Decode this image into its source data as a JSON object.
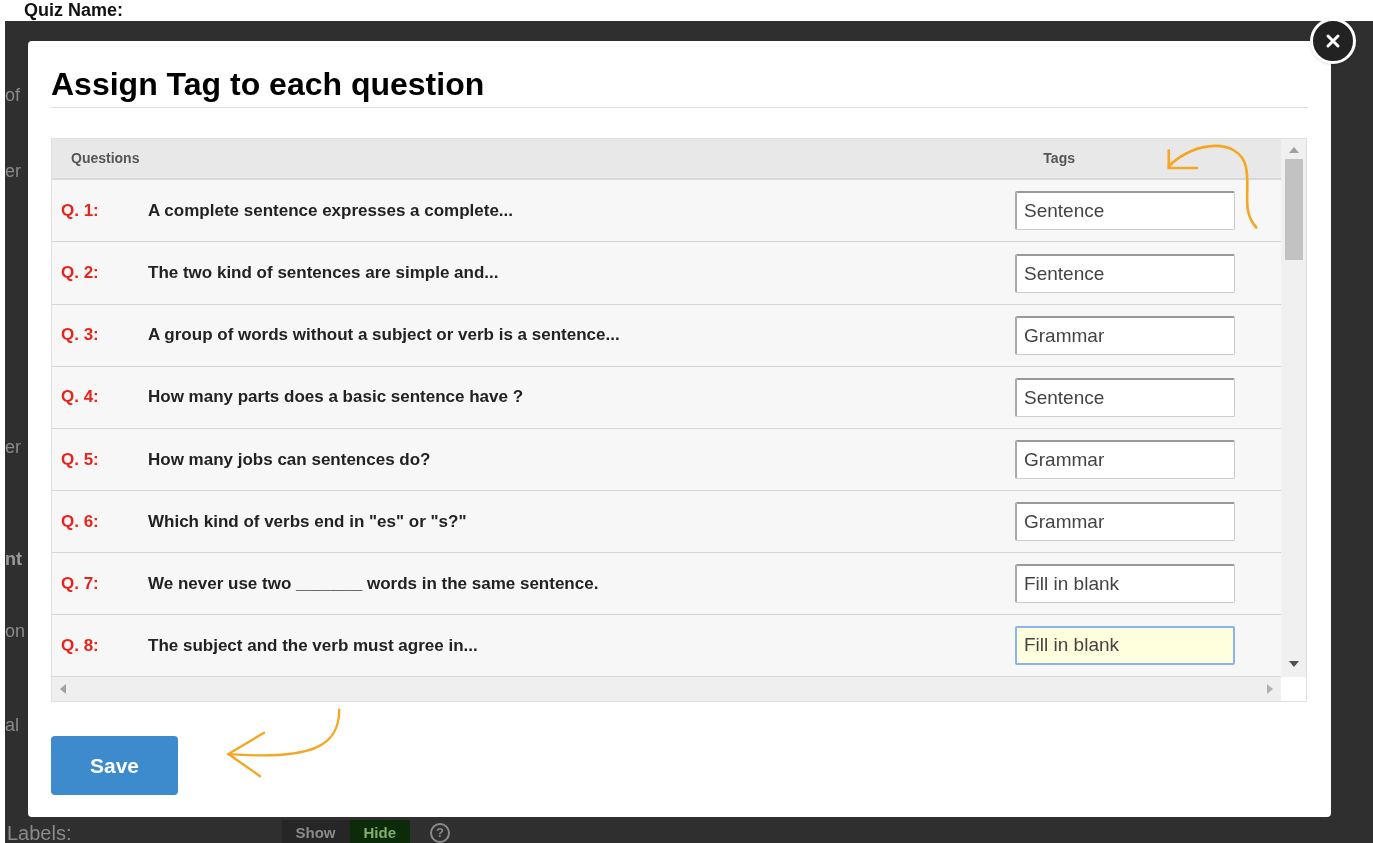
{
  "background": {
    "heading": "Quiz Name:",
    "fragments": [
      {
        "text": "of",
        "bold": false
      },
      {
        "text": "er",
        "bold": false
      },
      {
        "text": "er",
        "bold": false
      },
      {
        "text": "nt",
        "bold": true
      },
      {
        "text": "on",
        "bold": false
      },
      {
        "text": "al",
        "bold": false
      }
    ],
    "labels_row": {
      "label": "Labels:",
      "options": [
        {
          "label": "Show",
          "selected": false
        },
        {
          "label": "Hide",
          "selected": true
        }
      ],
      "help": "?"
    }
  },
  "dialog": {
    "title": "Assign Tag to each question",
    "table": {
      "columns": [
        "Questions",
        "Tags"
      ],
      "rows": [
        {
          "number": "Q. 1:",
          "question": "A complete sentence expresses a complete...",
          "tag": "Sentence",
          "focused": false
        },
        {
          "number": "Q. 2:",
          "question": "The two kind of sentences are simple and...",
          "tag": "Sentence",
          "focused": false
        },
        {
          "number": "Q. 3:",
          "question": "A group of words without a subject or verb is a sentence...",
          "tag": "Grammar",
          "focused": false
        },
        {
          "number": "Q. 4:",
          "question": "How many parts does a basic sentence have ?",
          "tag": "Sentence",
          "focused": false
        },
        {
          "number": "Q. 5:",
          "question": "How many jobs can sentences do?",
          "tag": "Grammar",
          "focused": false
        },
        {
          "number": "Q. 6:",
          "question": "Which kind of verbs end in \"es\" or \"s?\"",
          "tag": "Grammar",
          "focused": false
        },
        {
          "number": "Q. 7:",
          "question": "We never use two _______ words in the same sentence.",
          "tag": "Fill in blank",
          "focused": false
        },
        {
          "number": "Q. 8:",
          "question": "The subject and the verb must agree in...",
          "tag": "Fill in blank",
          "focused": true
        }
      ]
    },
    "save_button": "Save"
  }
}
